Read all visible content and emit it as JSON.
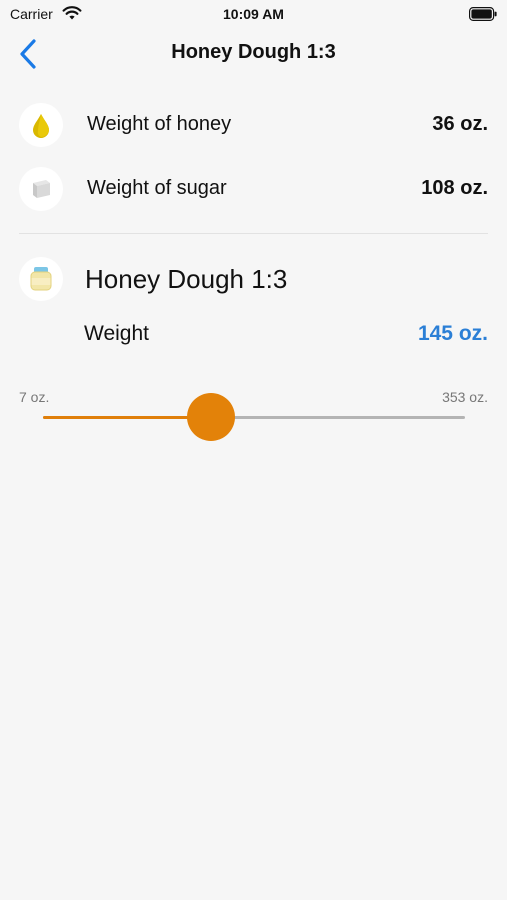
{
  "status_bar": {
    "carrier": "Carrier",
    "time": "10:09 AM"
  },
  "nav": {
    "title": "Honey Dough 1:3",
    "back_icon": "chevron-left-icon"
  },
  "ingredients": [
    {
      "label": "Weight of honey",
      "value": "36 oz.",
      "icon": "honey-drop-icon"
    },
    {
      "label": "Weight of sugar",
      "value": "108 oz.",
      "icon": "sugar-cube-icon"
    }
  ],
  "result": {
    "title": "Honey Dough 1:3",
    "icon": "dough-jar-icon"
  },
  "weight": {
    "label": "Weight",
    "value": "145 oz."
  },
  "slider": {
    "min_label": "7 oz.",
    "max_label": "353 oz.",
    "min": 7,
    "max": 353,
    "value": 145
  },
  "colors": {
    "accent_orange": "#e38209",
    "value_blue": "#2b7fd6",
    "back_blue": "#1a7ae6"
  }
}
